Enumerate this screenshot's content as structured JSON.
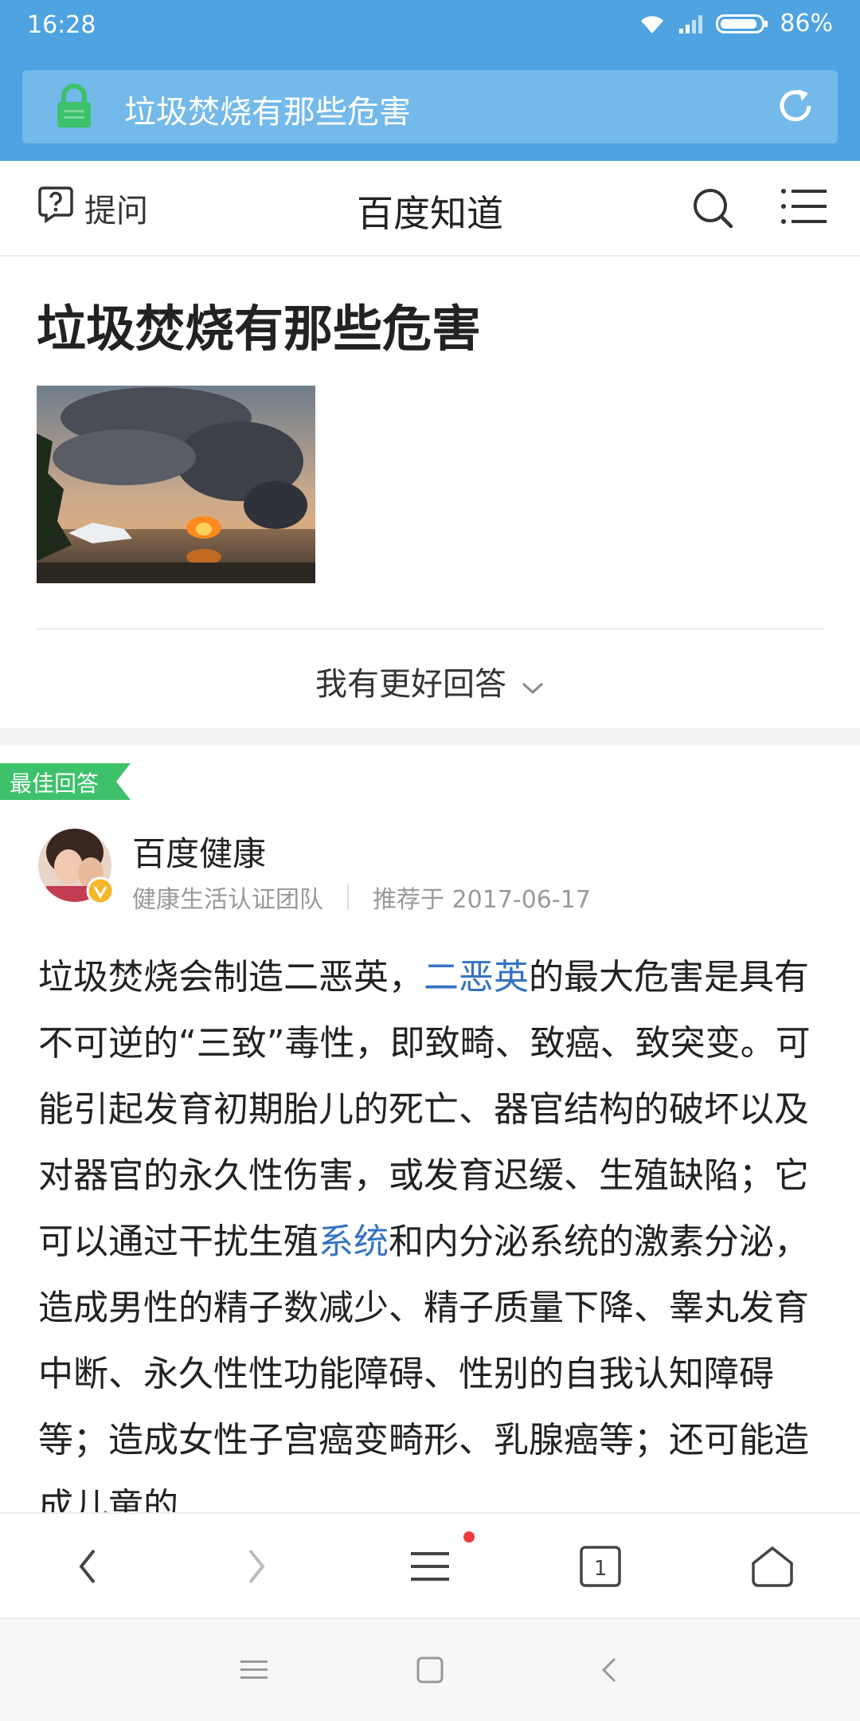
{
  "status_bar": {
    "time": "16:28",
    "battery": "86%"
  },
  "url_bar": {
    "text": "垃圾焚烧有那些危害"
  },
  "header": {
    "ask_label": "提问",
    "site_title": "百度知道"
  },
  "question": {
    "title": "垃圾焚烧有那些危害",
    "better_answer_label": "我有更好回答"
  },
  "best_answer": {
    "badge": "最佳回答",
    "author_name": "百度健康",
    "author_team": "健康生活认证团队",
    "recommended": "推荐于 2017-06-17",
    "body": {
      "t1": "垃圾焚烧会制造二恶英，",
      "link1": "二恶英",
      "t2": "的最大危害是具有不可逆的“三致”毒性，即致畸、致癌、致突变。可能引起发育初期胎儿的死亡、器官结构的破坏以及对器官的永久性伤害，或发育迟缓、生殖缺陷；它可以通过干扰生殖",
      "link2": "系统",
      "t3": "和内分泌系统的激素分泌，造成男性的精子数减少、精子质量下降、睾丸发育中断、永久性性功能障碍、性别的自我认知障碍等；造成女性子宫癌变畸形、乳腺癌等；还可能造成儿童的"
    }
  },
  "toolbar": {
    "tab_count": "1"
  },
  "colors": {
    "accent": "#4ea3e0",
    "badge": "#3dc16b",
    "link": "#3473c3",
    "notify_dot": "#ef3b3b"
  }
}
